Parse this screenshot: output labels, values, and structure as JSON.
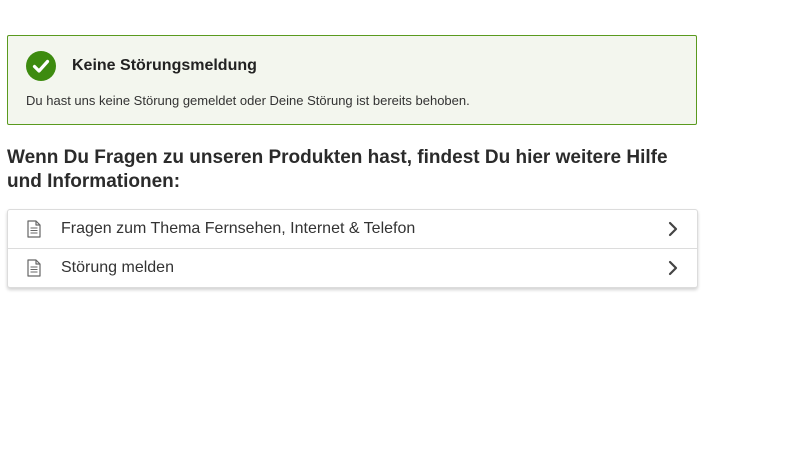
{
  "status_notice": {
    "title": "Keine Störungsmeldung",
    "text": "Du hast uns keine Störung gemeldet oder Deine Störung ist bereits behoben.",
    "icon": "check-circle-icon",
    "accent_color": "#3d8b0f",
    "border_color": "#5a9a1e",
    "background_color": "#f3f6ee"
  },
  "help": {
    "heading": "Wenn Du Fragen zu unseren Produkten hast, findest Du hier weitere Hilfe und Informationen:",
    "links": [
      {
        "label": "Fragen zum Thema Fernsehen, Internet & Telefon",
        "icon": "document-icon",
        "trailing_icon": "chevron-right-icon"
      },
      {
        "label": "Störung melden",
        "icon": "document-icon",
        "trailing_icon": "chevron-right-icon"
      }
    ]
  }
}
